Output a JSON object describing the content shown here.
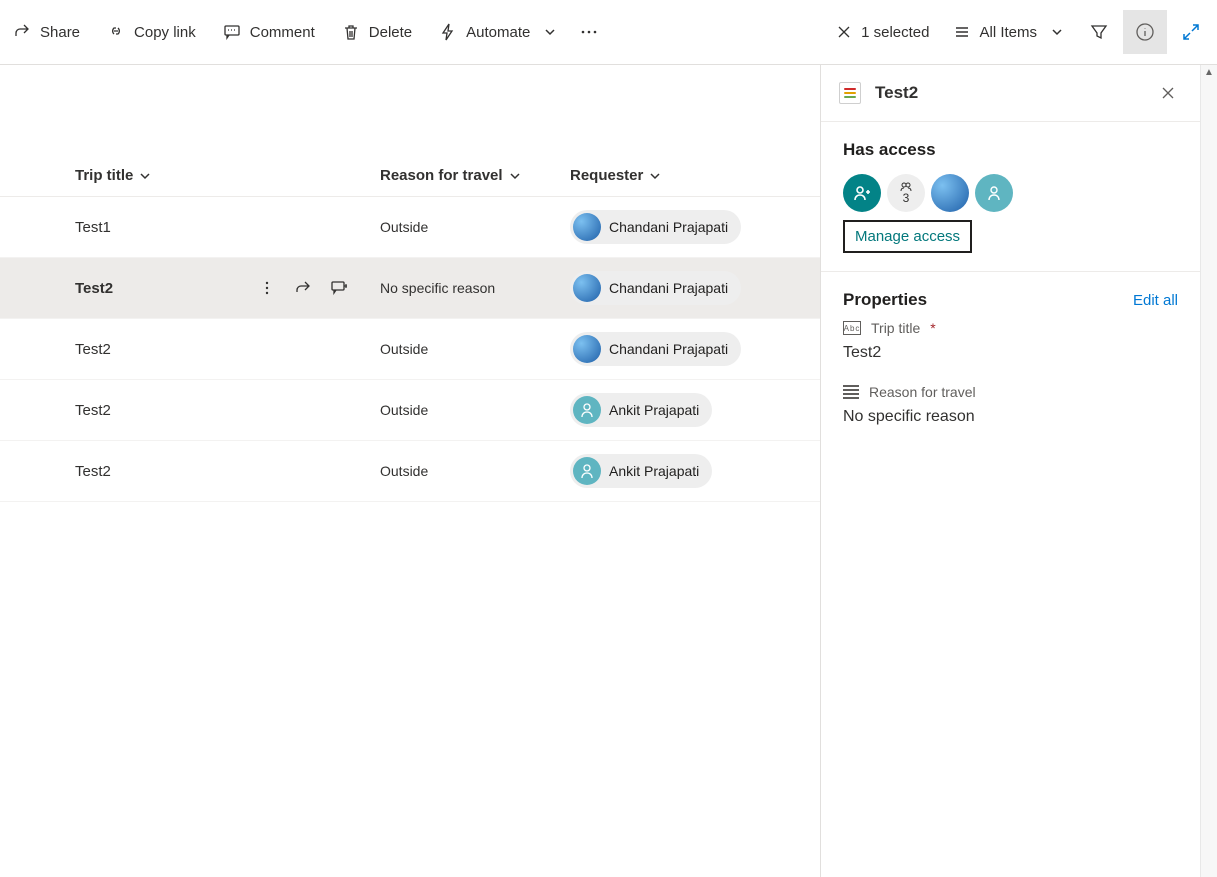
{
  "toolbar": {
    "share": "Share",
    "copylink": "Copy link",
    "comment": "Comment",
    "delete": "Delete",
    "automate": "Automate",
    "selected": "1 selected",
    "view": "All Items"
  },
  "columns": {
    "title": "Trip title",
    "reason": "Reason for travel",
    "requester": "Requester"
  },
  "rows": [
    {
      "title": "Test1",
      "reason": "Outside",
      "requester": "Chandani Prajapati",
      "avatar": "blue",
      "selected": false
    },
    {
      "title": "Test2",
      "reason": "No specific reason",
      "requester": "Chandani Prajapati",
      "avatar": "blue",
      "selected": true
    },
    {
      "title": "Test2",
      "reason": "Outside",
      "requester": "Chandani Prajapati",
      "avatar": "blue",
      "selected": false
    },
    {
      "title": "Test2",
      "reason": "Outside",
      "requester": "Ankit Prajapati",
      "avatar": "teal",
      "selected": false
    },
    {
      "title": "Test2",
      "reason": "Outside",
      "requester": "Ankit Prajapati",
      "avatar": "teal",
      "selected": false
    }
  ],
  "panel": {
    "title": "Test2",
    "access_header": "Has access",
    "access_count": "3",
    "manage": "Manage access",
    "properties_header": "Properties",
    "editall": "Edit all",
    "fields": {
      "triptitle_label": "Trip title",
      "triptitle_value": "Test2",
      "reason_label": "Reason for travel",
      "reason_value": "No specific reason"
    }
  }
}
